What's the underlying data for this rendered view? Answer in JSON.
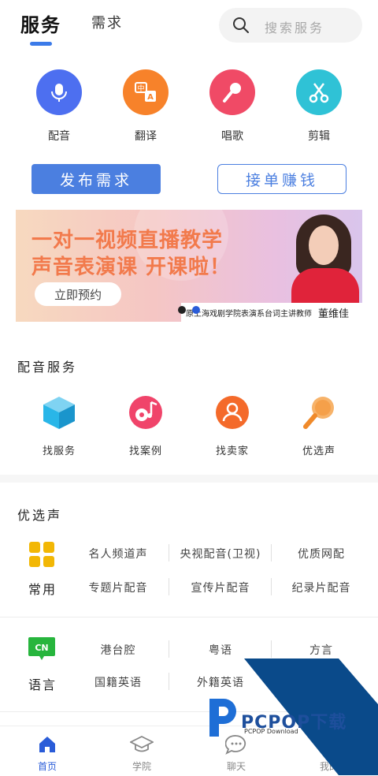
{
  "header": {
    "tabs": [
      {
        "label": "服务",
        "active": true
      },
      {
        "label": "需求",
        "active": false
      }
    ],
    "search_placeholder": "搜索服务"
  },
  "categories": [
    {
      "label": "配音",
      "icon": "microphone-icon",
      "color": "#4d6ff0"
    },
    {
      "label": "翻译",
      "icon": "translate-icon",
      "color": "#f7822a"
    },
    {
      "label": "唱歌",
      "icon": "karaoke-mic-icon",
      "color": "#f04a66"
    },
    {
      "label": "剪辑",
      "icon": "scissors-icon",
      "color": "#2fc2d6"
    }
  ],
  "actions": {
    "publish": "发布需求",
    "accept": "接单赚钱"
  },
  "banner": {
    "line1": "一对一视频直播教学",
    "line2": "声音表演课 开课啦！",
    "button": "立即预约",
    "caption": "原上海戏剧学院表演系台词主讲教师",
    "name": "董维佳",
    "slides": 2,
    "active_slide": 2
  },
  "dubbing_services": {
    "title": "配音服务",
    "items": [
      {
        "label": "找服务",
        "icon": "cube-icon",
        "color": "#29b6e8"
      },
      {
        "label": "找案例",
        "icon": "music-disc-icon",
        "color": "#f0446a"
      },
      {
        "label": "找卖家",
        "icon": "user-icon",
        "color": "#f46a2a"
      },
      {
        "label": "优选声",
        "icon": "karaoke-mic-icon",
        "color": "#f5a04a"
      }
    ]
  },
  "preferred_voice": {
    "title": "优选声",
    "groups": [
      {
        "label": "常用",
        "icon": "grid-icon",
        "icon_color": "#f2b705",
        "rows": [
          [
            "名人频道声",
            "央视配音(卫视)",
            "优质网配"
          ],
          [
            "专题片配音",
            "宣传片配音",
            "纪录片配音"
          ]
        ]
      },
      {
        "label": "语言",
        "icon": "cn-badge-icon",
        "icon_text": "CN",
        "icon_color": "#27b53d",
        "rows": [
          [
            "港台腔",
            "粤语",
            "方言"
          ],
          [
            "国籍英语",
            "外籍英语",
            ""
          ]
        ]
      }
    ]
  },
  "bottom_nav": [
    {
      "label": "首页",
      "icon": "home-icon",
      "active": true
    },
    {
      "label": "学院",
      "icon": "graduation-cap-icon",
      "active": false
    },
    {
      "label": "聊天",
      "icon": "chat-icon",
      "active": false
    },
    {
      "label": "我的",
      "icon": "profile-icon",
      "active": false
    }
  ],
  "watermark": {
    "brand": "PCPOP下载",
    "sub": "PCPOP Download"
  },
  "colors": {
    "accent": "#4b7fe0",
    "banner_text": "#f27a4c"
  }
}
